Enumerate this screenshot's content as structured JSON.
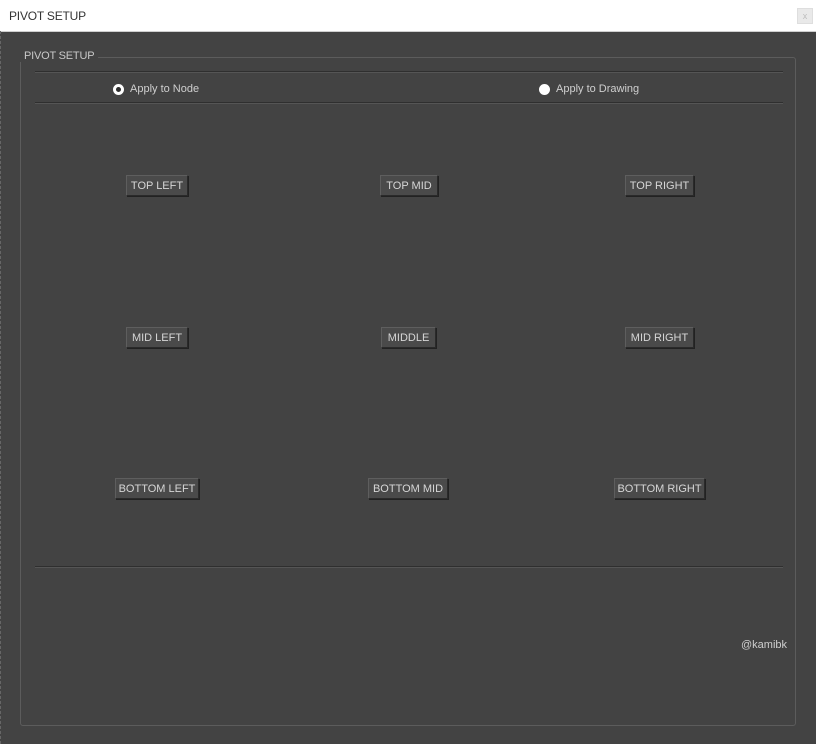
{
  "window": {
    "title": "PIVOT SETUP",
    "close_label": "x"
  },
  "group": {
    "title": "PIVOT SETUP"
  },
  "apply_options": [
    {
      "label": "Apply to Node",
      "checked": true
    },
    {
      "label": "Apply to Drawing",
      "checked": false
    }
  ],
  "pivot_buttons": {
    "top_left": "TOP LEFT",
    "top_mid": "TOP MID",
    "top_right": "TOP RIGHT",
    "mid_left": "MID LEFT",
    "middle": "MIDDLE",
    "mid_right": "MID RIGHT",
    "bottom_left": "BOTTOM LEFT",
    "bottom_mid": "BOTTOM MID",
    "bottom_right": "BOTTOM RIGHT"
  },
  "footer": {
    "credit": "@kamibk"
  },
  "colors": {
    "background": "#434343",
    "titlebar": "#ffffff",
    "button": "#4a4a4a"
  }
}
